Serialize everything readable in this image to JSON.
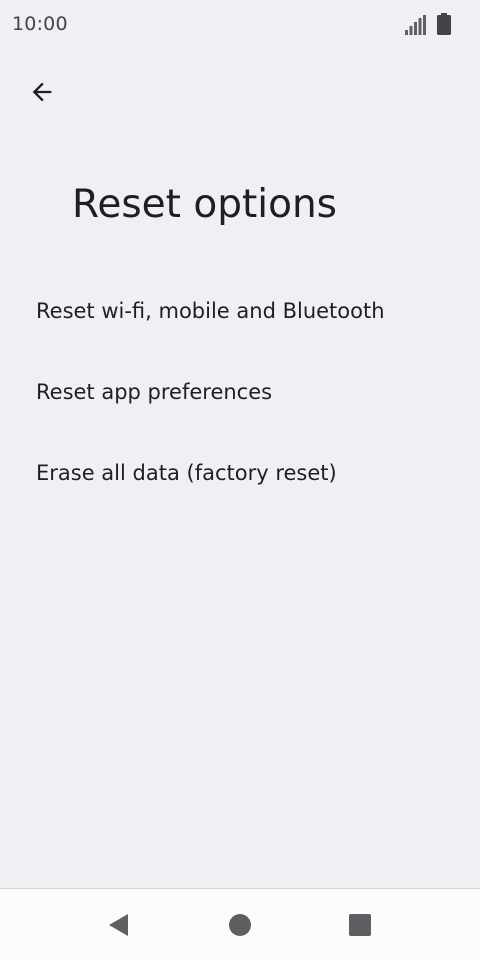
{
  "status_bar": {
    "time": "10:00",
    "icons": [
      "signal-icon",
      "battery-icon"
    ]
  },
  "header": {
    "back_icon": "arrow-left-icon",
    "title": "Reset options"
  },
  "options": [
    {
      "label": "Reset wi-fi, mobile and Bluetooth"
    },
    {
      "label": "Reset app preferences"
    },
    {
      "label": "Erase all data (factory reset)"
    }
  ],
  "nav_bar": {
    "icons": [
      "nav-back-icon",
      "nav-home-icon",
      "nav-recents-icon"
    ]
  },
  "colors": {
    "background": "#eff0f3",
    "text": "#1f1f23",
    "nav_background": "#fbfbfb",
    "icon": "#5f5f63"
  }
}
